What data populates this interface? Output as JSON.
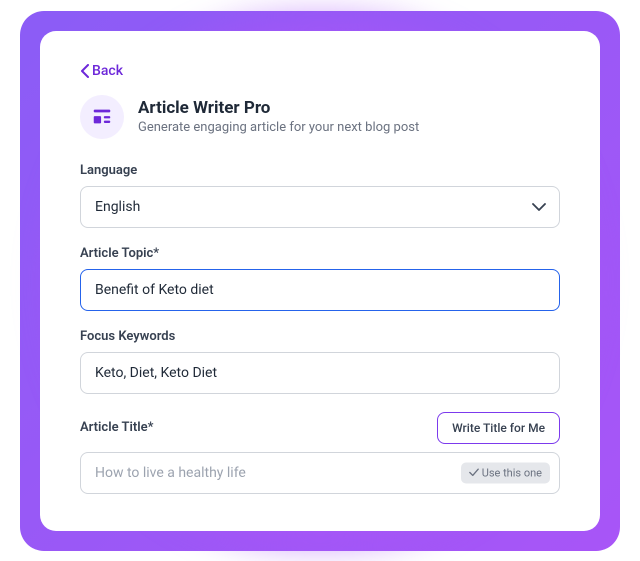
{
  "nav": {
    "back_label": "Back"
  },
  "header": {
    "title": "Article Writer Pro",
    "subtitle": "Generate engaging article for your next blog post"
  },
  "form": {
    "language": {
      "label": "Language",
      "value": "English"
    },
    "topic": {
      "label": "Article Topic*",
      "value": "Benefit of Keto diet"
    },
    "keywords": {
      "label": "Focus Keywords",
      "value": "Keto, Diet, Keto Diet"
    },
    "title": {
      "label": "Article Title*",
      "placeholder": "How to live a healthy life",
      "write_btn": "Write Title for Me",
      "use_badge": "Use this one"
    }
  }
}
